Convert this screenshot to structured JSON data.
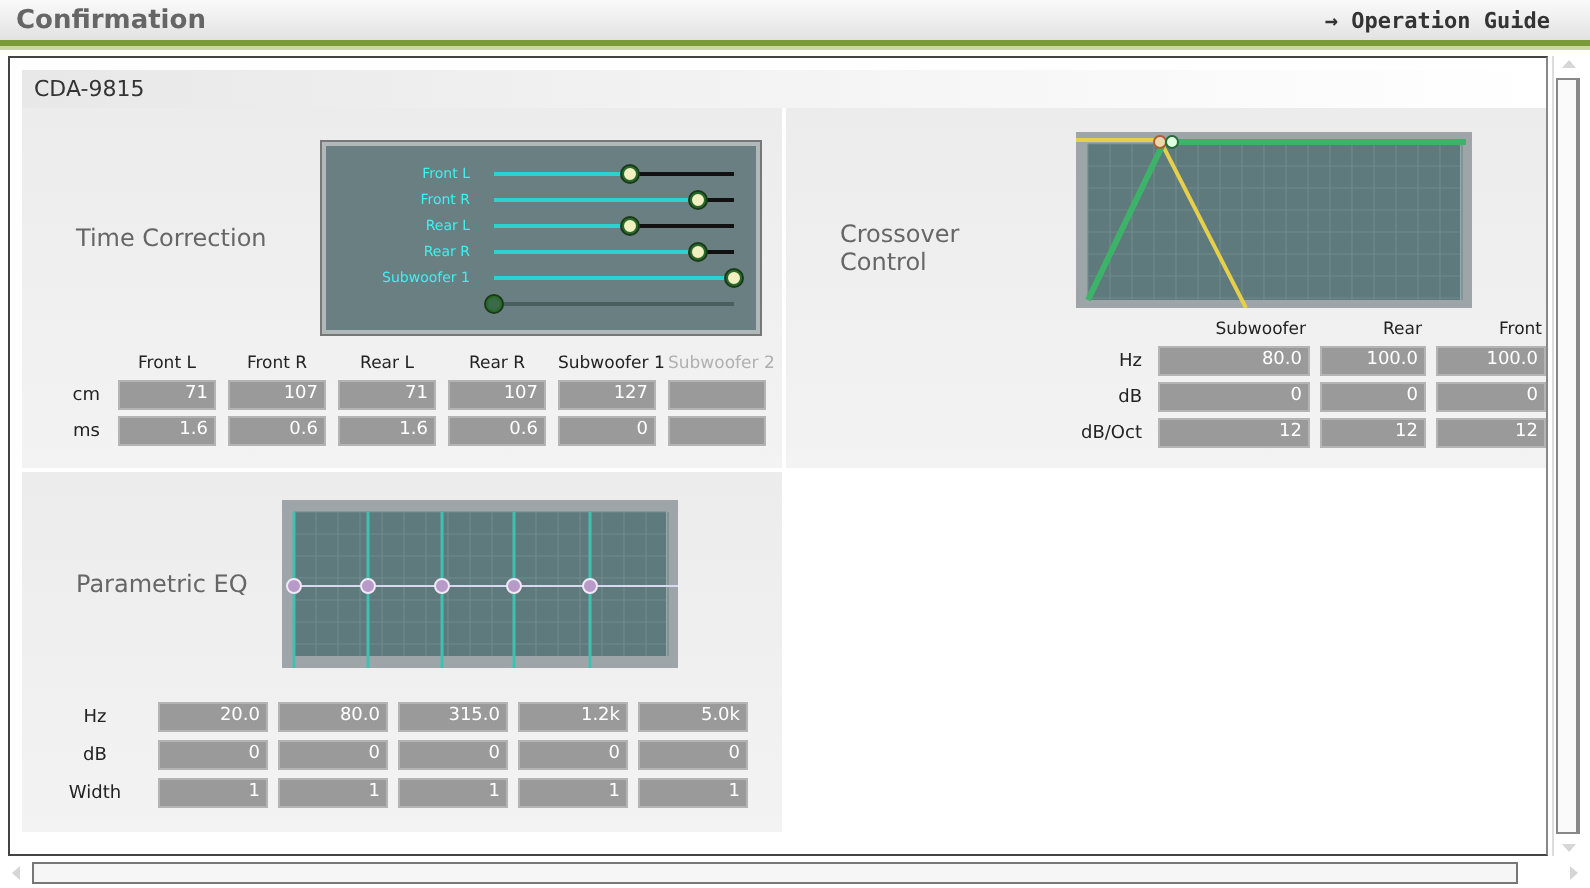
{
  "window": {
    "title": "Confirmation",
    "guide_link": "Operation Guide",
    "guide_arrow": "→"
  },
  "device": "CDA-9815",
  "time_correction": {
    "title": "Time Correction",
    "sliders": [
      {
        "label": "Front L",
        "level": 0.57,
        "disabled": false
      },
      {
        "label": "Front R",
        "level": 0.85,
        "disabled": false
      },
      {
        "label": "Rear L",
        "level": 0.57,
        "disabled": false
      },
      {
        "label": "Rear R",
        "level": 0.85,
        "disabled": false
      },
      {
        "label": "Subwoofer 1",
        "level": 1.0,
        "disabled": false
      },
      {
        "level": 0.0,
        "disabled": true
      }
    ],
    "columns": [
      {
        "label": "Front L",
        "disabled": false
      },
      {
        "label": "Front R",
        "disabled": false
      },
      {
        "label": "Rear L",
        "disabled": false
      },
      {
        "label": "Rear R",
        "disabled": false
      },
      {
        "label": "Subwoofer 1",
        "disabled": false
      },
      {
        "label": "Subwoofer 2",
        "disabled": true
      }
    ],
    "rows": [
      {
        "label": "cm",
        "values": [
          "71",
          "107",
          "71",
          "107",
          "127"
        ]
      },
      {
        "label": "ms",
        "values": [
          "1.6",
          "0.6",
          "1.6",
          "0.6",
          "0"
        ]
      }
    ]
  },
  "crossover": {
    "title": "Crossover Control",
    "columns": [
      "Subwoofer",
      "Rear",
      "Front"
    ],
    "rows": [
      {
        "label": "Hz",
        "values": [
          "80.0",
          "100.0",
          "100.0"
        ]
      },
      {
        "label": "dB",
        "values": [
          "0",
          "0",
          "0"
        ]
      },
      {
        "label": "dB/Oct",
        "values": [
          "12",
          "12",
          "12"
        ]
      }
    ]
  },
  "parametric_eq": {
    "title": "Parametric EQ",
    "rows": [
      {
        "label": "Hz",
        "values": [
          "20.0",
          "80.0",
          "315.0",
          "1.2k",
          "5.0k"
        ]
      },
      {
        "label": "dB",
        "values": [
          "0",
          "0",
          "0",
          "0",
          "0"
        ]
      },
      {
        "label": "Width",
        "values": [
          "1",
          "1",
          "1",
          "1",
          "1"
        ]
      }
    ]
  }
}
